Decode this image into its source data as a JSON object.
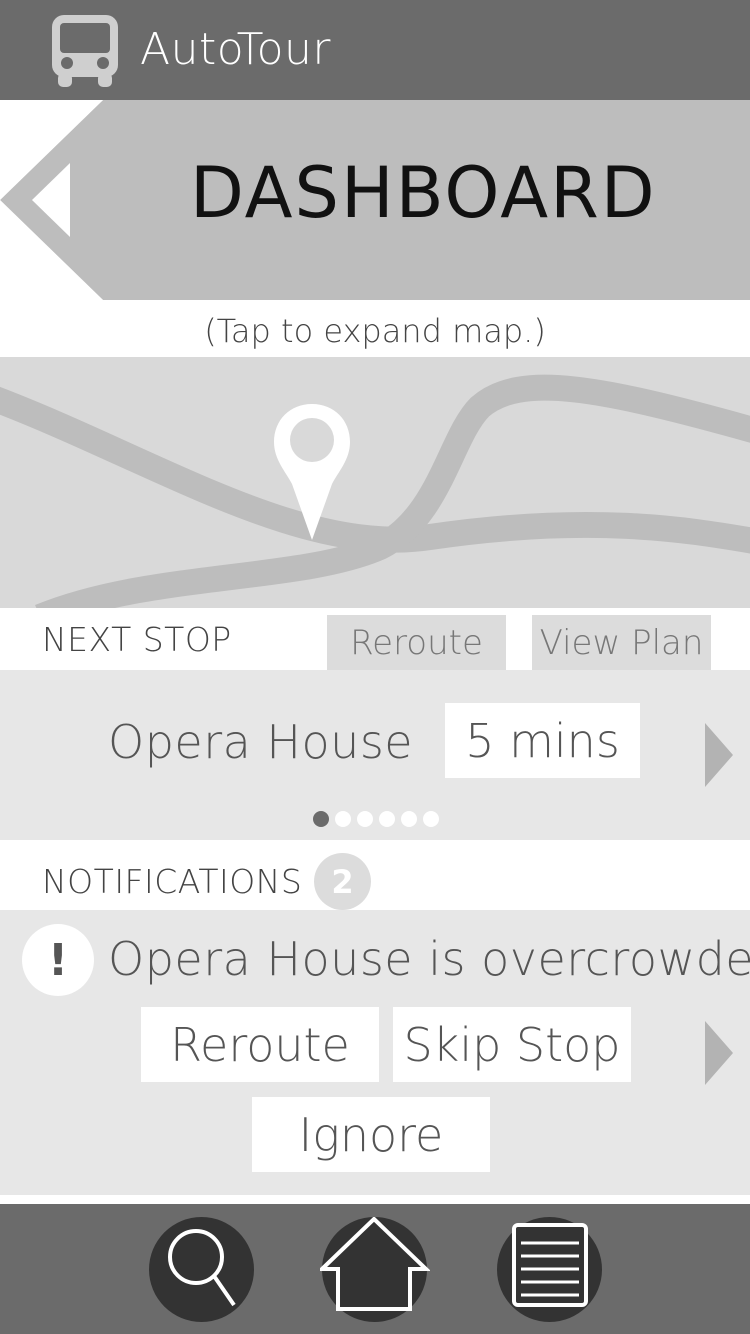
{
  "app": {
    "title": "AutoTour",
    "logo_icon": "bus-icon"
  },
  "header": {
    "title": "DASHBOARD",
    "back_icon": "back-arrow-icon"
  },
  "map": {
    "hint": "(Tap to expand map.)",
    "pin_icon": "map-pin-icon"
  },
  "next_stop": {
    "label": "NEXT STOP",
    "reroute_label": "Reroute",
    "view_plan_label": "View Plan",
    "stop_name": "Opera House",
    "eta": "5 mins",
    "pager_total": 6,
    "pager_current": 1
  },
  "notifications": {
    "label": "NOTIFICATIONS",
    "count": "2",
    "items": [
      {
        "icon": "alert-icon",
        "mark": "!",
        "text": "Opera House is overcrowded",
        "actions": [
          "Reroute",
          "Skip Stop",
          "Ignore"
        ]
      }
    ]
  },
  "bottom_nav": {
    "items": [
      "search-icon",
      "home-icon",
      "list-icon"
    ]
  },
  "colors": {
    "app_bar": "#6b6b6b",
    "header_bg": "#bdbdbd",
    "card_bg": "#e7e7e7",
    "map_bg": "#d9d9d9",
    "nav_button": "#333333"
  }
}
